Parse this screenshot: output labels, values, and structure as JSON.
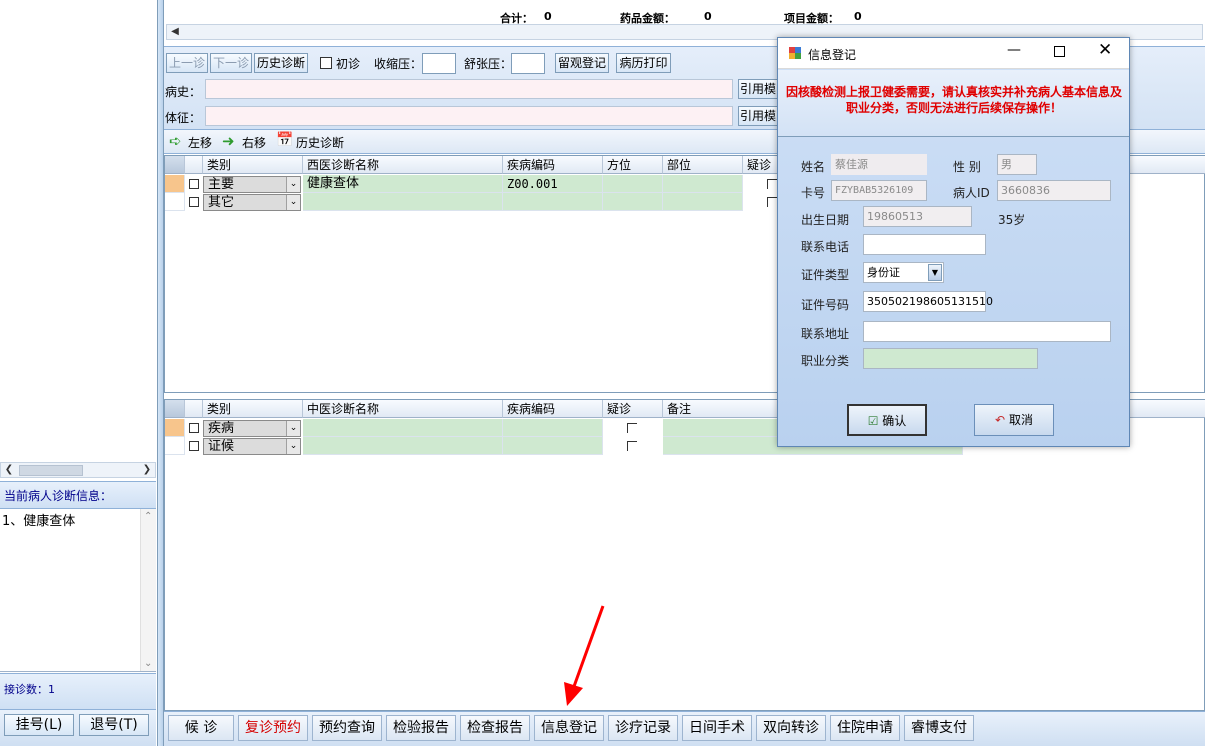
{
  "summary": {
    "total_label": "合计：",
    "total_value": "0",
    "drug_label": "药品金额：",
    "drug_value": "0",
    "item_label": "项目金额：",
    "item_value": "0"
  },
  "toolbar": {
    "prev_visit": "上一诊",
    "next_visit": "下一诊",
    "history_btn": "历史诊断",
    "first_visit_label": "初诊",
    "systolic_label": "收缩压：",
    "diastolic_label": "舒张压：",
    "observe_btn": "留观登记",
    "record_print_btn": "病历打印",
    "history_field_label": "病史：",
    "exam_field_label": "体征：",
    "cite_template_1": "引用模",
    "cite_template_2": "引用模"
  },
  "subtoolbar": {
    "left_shift": "左移",
    "right_shift": "右移",
    "history": "历史诊断"
  },
  "western_grid": {
    "headers": [
      "类别",
      "西医诊断名称",
      "疾病编码",
      "方位",
      "部位",
      "疑诊"
    ],
    "rows": [
      {
        "category": "主要",
        "name": "健康查体",
        "code": "Z00.001"
      },
      {
        "category": "其它",
        "name": "",
        "code": ""
      }
    ]
  },
  "tcm_grid": {
    "headers": [
      "类别",
      "中医诊断名称",
      "疾病编码",
      "疑诊",
      "备注"
    ],
    "rows": [
      {
        "category": "疾病"
      },
      {
        "category": "证候"
      }
    ]
  },
  "left": {
    "diag_info_label": "当前病人诊断信息：",
    "diag_info_text": "1、健康查体",
    "visit_count": "接诊数：1",
    "register_btn": "挂号(L)",
    "unregister_btn": "退号(T)"
  },
  "bottom_tabs": [
    {
      "label": "候 诊"
    },
    {
      "label": "复诊预约",
      "color": "#d40000"
    },
    {
      "label": "预约查询"
    },
    {
      "label": "检验报告"
    },
    {
      "label": "检查报告"
    },
    {
      "label": "信息登记"
    },
    {
      "label": "诊疗记录"
    },
    {
      "label": "日间手术"
    },
    {
      "label": "双向转诊"
    },
    {
      "label": "住院申请"
    },
    {
      "label": "睿博支付"
    }
  ],
  "dialog": {
    "title": "信息登记",
    "warning": "因核酸检测上报卫健委需要，请认真核实并补充病人基本信息及职业分类，否则无法进行后续保存操作！",
    "name_label": "姓名",
    "name_value": "蔡佳源",
    "gender_label": "性  别",
    "gender_value": "男",
    "card_label": "卡号",
    "card_value": "FZYBAB5326109",
    "patient_id_label": "病人ID",
    "patient_id_value": "3660836",
    "birth_label": "出生日期",
    "birth_value": "19860513",
    "age_value": "35岁",
    "phone_label": "联系电话",
    "phone_value": "",
    "id_type_label": "证件类型",
    "id_type_value": "身份证",
    "id_number_label": "证件号码",
    "id_number_value": "350502198605131510",
    "address_label": "联系地址",
    "address_value": "",
    "occupation_label": "职业分类",
    "occupation_value": "",
    "confirm_btn": "确认",
    "cancel_btn": "取消"
  },
  "colors": {
    "warning_red": "#e00000",
    "accent_blue": "#00008b",
    "annotation_arrow": "#ff0000"
  }
}
